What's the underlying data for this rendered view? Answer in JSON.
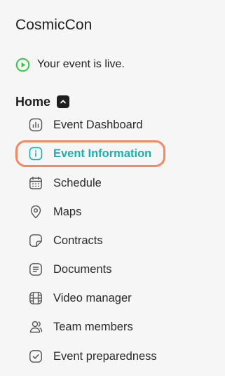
{
  "app": {
    "title": "CosmicCon"
  },
  "status": {
    "text": "Your event is live.",
    "icon": "play-circle-icon",
    "color": "#2ecc40"
  },
  "section": {
    "title": "Home",
    "toggle_icon": "chevron-up-icon"
  },
  "nav": {
    "active_color": "#1bb0b0",
    "highlight_color": "#f08a62",
    "items": [
      {
        "label": "Event Dashboard",
        "icon": "chart-icon",
        "active": false
      },
      {
        "label": "Event Information",
        "icon": "info-icon",
        "active": true
      },
      {
        "label": "Schedule",
        "icon": "calendar-icon",
        "active": false
      },
      {
        "label": "Maps",
        "icon": "map-pin-icon",
        "active": false
      },
      {
        "label": "Contracts",
        "icon": "contract-icon",
        "active": false
      },
      {
        "label": "Documents",
        "icon": "document-icon",
        "active": false
      },
      {
        "label": "Video manager",
        "icon": "video-icon",
        "active": false
      },
      {
        "label": "Team members",
        "icon": "team-icon",
        "active": false
      },
      {
        "label": "Event preparedness",
        "icon": "checklist-icon",
        "active": false
      }
    ]
  }
}
